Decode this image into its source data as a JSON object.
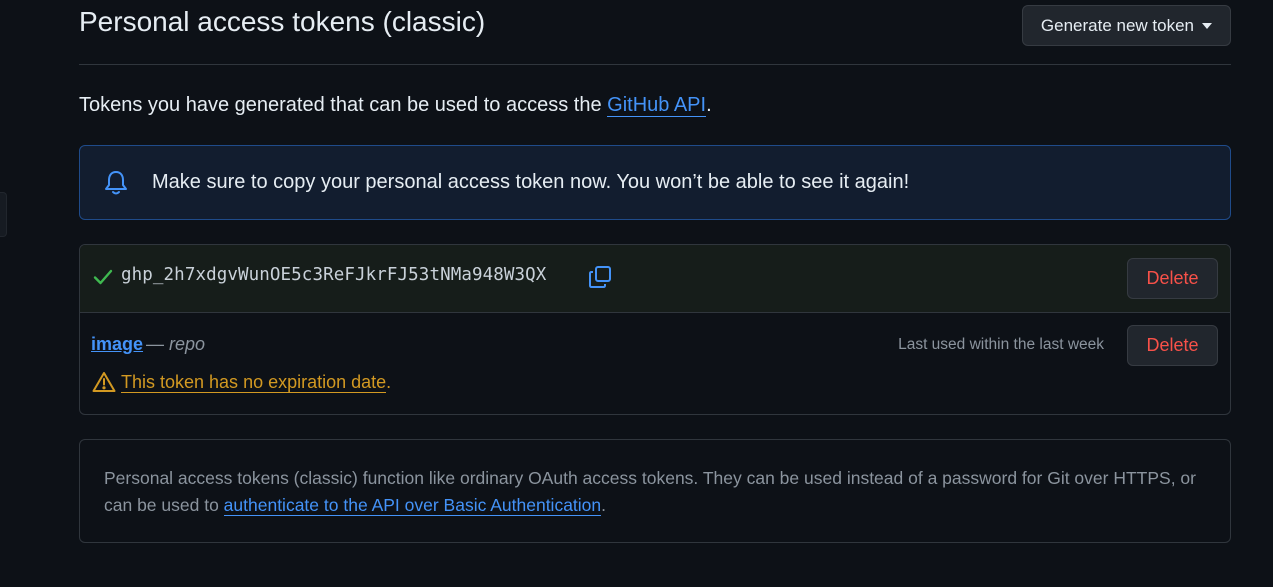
{
  "header": {
    "title": "Personal access tokens (classic)",
    "generate_label": "Generate new token"
  },
  "intro": {
    "text": "Tokens you have generated that can be used to access the ",
    "link": "GitHub API",
    "suffix": "."
  },
  "flash": {
    "icon": "bell-icon",
    "message": "Make sure to copy your personal access token now. You won’t be able to see it again!"
  },
  "new_token": {
    "value": "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",
    "delete_label": "Delete"
  },
  "token": {
    "name": "image",
    "separator": " — ",
    "scope": "repo",
    "last_used": "Last used within the last week",
    "delete_label": "Delete",
    "warning_link": "This token has no expiration date",
    "warning_suffix": "."
  },
  "info": {
    "text": "Personal access tokens (classic) function like ordinary OAuth access tokens. They can be used instead of a password for Git over HTTPS, or can be used to ",
    "link": "authenticate to the API over Basic Authentication",
    "suffix": "."
  },
  "colors": {
    "background": "#0d1117",
    "accent": "#4493f8",
    "danger": "#f85149",
    "warning": "#d29922",
    "success": "#3fb950"
  }
}
